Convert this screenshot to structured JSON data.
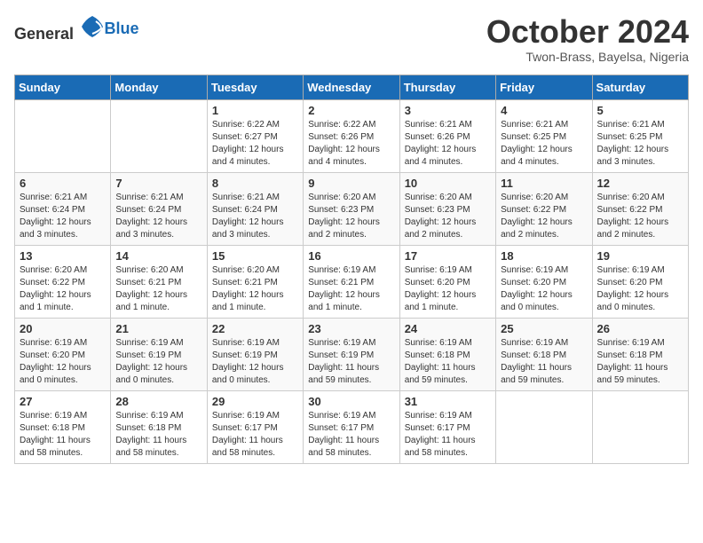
{
  "header": {
    "logo_general": "General",
    "logo_blue": "Blue",
    "month_year": "October 2024",
    "location": "Twon-Brass, Bayelsa, Nigeria"
  },
  "weekdays": [
    "Sunday",
    "Monday",
    "Tuesday",
    "Wednesday",
    "Thursday",
    "Friday",
    "Saturday"
  ],
  "weeks": [
    [
      {
        "day": "",
        "info": ""
      },
      {
        "day": "",
        "info": ""
      },
      {
        "day": "1",
        "info": "Sunrise: 6:22 AM\nSunset: 6:27 PM\nDaylight: 12 hours and 4 minutes."
      },
      {
        "day": "2",
        "info": "Sunrise: 6:22 AM\nSunset: 6:26 PM\nDaylight: 12 hours and 4 minutes."
      },
      {
        "day": "3",
        "info": "Sunrise: 6:21 AM\nSunset: 6:26 PM\nDaylight: 12 hours and 4 minutes."
      },
      {
        "day": "4",
        "info": "Sunrise: 6:21 AM\nSunset: 6:25 PM\nDaylight: 12 hours and 4 minutes."
      },
      {
        "day": "5",
        "info": "Sunrise: 6:21 AM\nSunset: 6:25 PM\nDaylight: 12 hours and 3 minutes."
      }
    ],
    [
      {
        "day": "6",
        "info": "Sunrise: 6:21 AM\nSunset: 6:24 PM\nDaylight: 12 hours and 3 minutes."
      },
      {
        "day": "7",
        "info": "Sunrise: 6:21 AM\nSunset: 6:24 PM\nDaylight: 12 hours and 3 minutes."
      },
      {
        "day": "8",
        "info": "Sunrise: 6:21 AM\nSunset: 6:24 PM\nDaylight: 12 hours and 3 minutes."
      },
      {
        "day": "9",
        "info": "Sunrise: 6:20 AM\nSunset: 6:23 PM\nDaylight: 12 hours and 2 minutes."
      },
      {
        "day": "10",
        "info": "Sunrise: 6:20 AM\nSunset: 6:23 PM\nDaylight: 12 hours and 2 minutes."
      },
      {
        "day": "11",
        "info": "Sunrise: 6:20 AM\nSunset: 6:22 PM\nDaylight: 12 hours and 2 minutes."
      },
      {
        "day": "12",
        "info": "Sunrise: 6:20 AM\nSunset: 6:22 PM\nDaylight: 12 hours and 2 minutes."
      }
    ],
    [
      {
        "day": "13",
        "info": "Sunrise: 6:20 AM\nSunset: 6:22 PM\nDaylight: 12 hours and 1 minute."
      },
      {
        "day": "14",
        "info": "Sunrise: 6:20 AM\nSunset: 6:21 PM\nDaylight: 12 hours and 1 minute."
      },
      {
        "day": "15",
        "info": "Sunrise: 6:20 AM\nSunset: 6:21 PM\nDaylight: 12 hours and 1 minute."
      },
      {
        "day": "16",
        "info": "Sunrise: 6:19 AM\nSunset: 6:21 PM\nDaylight: 12 hours and 1 minute."
      },
      {
        "day": "17",
        "info": "Sunrise: 6:19 AM\nSunset: 6:20 PM\nDaylight: 12 hours and 1 minute."
      },
      {
        "day": "18",
        "info": "Sunrise: 6:19 AM\nSunset: 6:20 PM\nDaylight: 12 hours and 0 minutes."
      },
      {
        "day": "19",
        "info": "Sunrise: 6:19 AM\nSunset: 6:20 PM\nDaylight: 12 hours and 0 minutes."
      }
    ],
    [
      {
        "day": "20",
        "info": "Sunrise: 6:19 AM\nSunset: 6:20 PM\nDaylight: 12 hours and 0 minutes."
      },
      {
        "day": "21",
        "info": "Sunrise: 6:19 AM\nSunset: 6:19 PM\nDaylight: 12 hours and 0 minutes."
      },
      {
        "day": "22",
        "info": "Sunrise: 6:19 AM\nSunset: 6:19 PM\nDaylight: 12 hours and 0 minutes."
      },
      {
        "day": "23",
        "info": "Sunrise: 6:19 AM\nSunset: 6:19 PM\nDaylight: 11 hours and 59 minutes."
      },
      {
        "day": "24",
        "info": "Sunrise: 6:19 AM\nSunset: 6:18 PM\nDaylight: 11 hours and 59 minutes."
      },
      {
        "day": "25",
        "info": "Sunrise: 6:19 AM\nSunset: 6:18 PM\nDaylight: 11 hours and 59 minutes."
      },
      {
        "day": "26",
        "info": "Sunrise: 6:19 AM\nSunset: 6:18 PM\nDaylight: 11 hours and 59 minutes."
      }
    ],
    [
      {
        "day": "27",
        "info": "Sunrise: 6:19 AM\nSunset: 6:18 PM\nDaylight: 11 hours and 58 minutes."
      },
      {
        "day": "28",
        "info": "Sunrise: 6:19 AM\nSunset: 6:18 PM\nDaylight: 11 hours and 58 minutes."
      },
      {
        "day": "29",
        "info": "Sunrise: 6:19 AM\nSunset: 6:17 PM\nDaylight: 11 hours and 58 minutes."
      },
      {
        "day": "30",
        "info": "Sunrise: 6:19 AM\nSunset: 6:17 PM\nDaylight: 11 hours and 58 minutes."
      },
      {
        "day": "31",
        "info": "Sunrise: 6:19 AM\nSunset: 6:17 PM\nDaylight: 11 hours and 58 minutes."
      },
      {
        "day": "",
        "info": ""
      },
      {
        "day": "",
        "info": ""
      }
    ]
  ]
}
